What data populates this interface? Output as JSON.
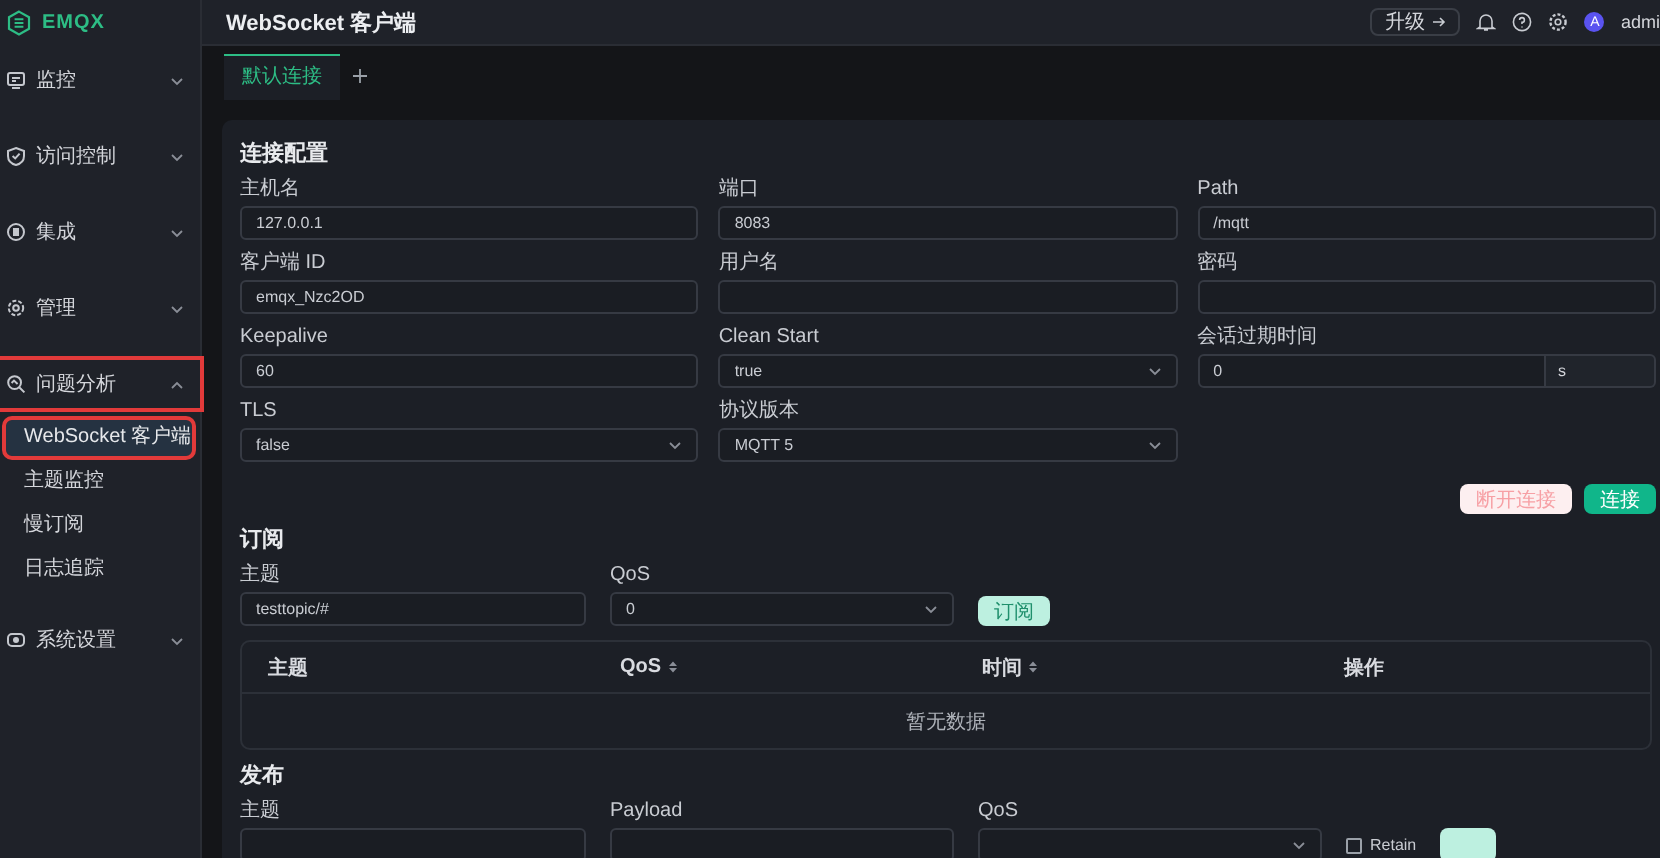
{
  "logo": {
    "text": "EMQX"
  },
  "header": {
    "title": "WebSocket 客户端",
    "upgrade_button": "升级",
    "avatar": "A",
    "user": "admi"
  },
  "sidebar": {
    "items": [
      {
        "label": "监控",
        "expanded": false,
        "highlighted": false
      },
      {
        "label": "访问控制",
        "expanded": false,
        "highlighted": false
      },
      {
        "label": "集成",
        "expanded": false,
        "highlighted": false
      },
      {
        "label": "管理",
        "expanded": false,
        "highlighted": false
      },
      {
        "label": "问题分析",
        "expanded": true,
        "highlighted": true,
        "children": [
          {
            "label": "WebSocket 客户端",
            "selected": true,
            "highlighted": true
          },
          {
            "label": "主题监控",
            "selected": false,
            "highlighted": false
          },
          {
            "label": "慢订阅",
            "selected": false,
            "highlighted": false
          },
          {
            "label": "日志追踪",
            "selected": false,
            "highlighted": false
          }
        ]
      },
      {
        "label": "系统设置",
        "expanded": false,
        "highlighted": false
      }
    ]
  },
  "tabs": [
    {
      "label": "默认连接",
      "selected": true
    }
  ],
  "connection": {
    "title": "连接配置",
    "fields": [
      {
        "label": "主机名",
        "kind": "input",
        "value": "127.0.0.1"
      },
      {
        "label": "端口",
        "kind": "input",
        "value": "8083"
      },
      {
        "label": "Path",
        "kind": "input",
        "value": "/mqtt"
      },
      {
        "label": "客户端 ID",
        "kind": "input",
        "value": "emqx_Nzc2OD"
      },
      {
        "label": "用户名",
        "kind": "input"
      },
      {
        "label": "密码",
        "kind": "input"
      },
      {
        "label": "Keepalive",
        "kind": "input",
        "value": "60"
      },
      {
        "label": "Clean Start",
        "kind": "select",
        "value": "true"
      },
      {
        "label": "会话过期时间",
        "kind": "unit",
        "value": "0",
        "unit": "s"
      },
      {
        "label": "TLS",
        "kind": "select",
        "value": "false"
      },
      {
        "label": "协议版本",
        "kind": "select",
        "value": "MQTT 5"
      }
    ],
    "buttons": [
      {
        "label": "断开连接",
        "kind": "danger",
        "disabled": true
      },
      {
        "label": "连接",
        "kind": "primary",
        "disabled": false
      }
    ]
  },
  "subscribe": {
    "title": "订阅",
    "fields": [
      {
        "label": "主题",
        "kind": "input",
        "value": "testtopic/#"
      },
      {
        "label": "QoS",
        "kind": "select",
        "value": "0"
      }
    ],
    "button": {
      "label": "订阅",
      "disabled": true
    },
    "table": {
      "columns": [
        {
          "label": "主题",
          "sortable": false
        },
        {
          "label": "QoS",
          "sortable": true
        },
        {
          "label": "时间",
          "sortable": true
        },
        {
          "label": "操作",
          "sortable": false
        }
      ],
      "empty": "暂无数据"
    }
  },
  "publish": {
    "title": "发布",
    "fields": [
      {
        "label": "主题",
        "kind": "input"
      },
      {
        "label": "Payload",
        "kind": "input"
      },
      {
        "label": "QoS",
        "kind": "select"
      }
    ],
    "retain": {
      "label": "Retain",
      "checked": false
    }
  }
}
